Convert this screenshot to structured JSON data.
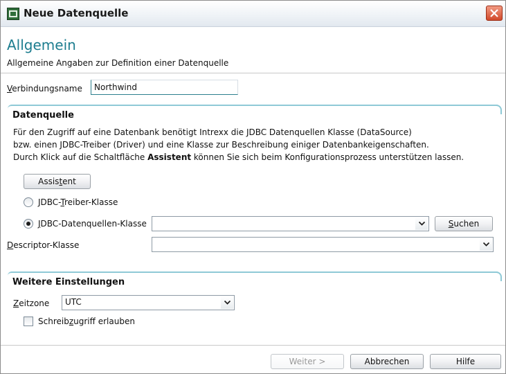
{
  "window": {
    "title": "Neue Datenquelle"
  },
  "header": {
    "heading": "Allgemein",
    "subheading": "Allgemeine Angaben zur Definition einer Datenquelle"
  },
  "connection": {
    "label_accel": "V",
    "label_rest": "erbindungsname",
    "value": "Northwind"
  },
  "datasource": {
    "group_title": "Datenquelle",
    "desc_line1": "Für den Zugriff auf eine Datenbank benötigt Intrexx die JDBC Datenquellen Klasse (DataSource)",
    "desc_line2": "bzw. einen JDBC-Treiber (Driver) und eine Klasse zur Beschreibung einiger Datenbankeigenschaften.",
    "desc_line3_a": "Durch Klick auf die Schaltfläche ",
    "desc_line3_b": "Assistent",
    "desc_line3_c": " können Sie sich beim Konfigurationsprozess unterstützen lassen.",
    "assistant_button": {
      "pre": "Assis",
      "accel": "t",
      "post": "ent"
    },
    "driver_radio": {
      "pre": "JDBC-",
      "accel": "T",
      "post": "reiber-Klasse",
      "checked": false
    },
    "ds_radio": {
      "pre": "",
      "accel": "J",
      "post": "DBC-Datenquellen-Klasse",
      "checked": true,
      "value": ""
    },
    "search_button": {
      "pre": "",
      "accel": "S",
      "post": "uchen"
    },
    "descriptor": {
      "label_accel": "D",
      "label_rest": "escriptor-Klasse",
      "value": ""
    }
  },
  "further": {
    "group_title": "Weitere Einstellungen",
    "timezone": {
      "label_accel": "Z",
      "label_rest": "eitzone",
      "value": "UTC"
    },
    "write_access": {
      "pre": "Schreib",
      "accel": "z",
      "post": "ugriff erlauben",
      "checked": false
    }
  },
  "footer": {
    "next_button": "Weiter >",
    "cancel_button": "Abbrechen",
    "help_button": "Hilfe"
  },
  "colors": {
    "heading": "#1d7d8f",
    "group_border": "#8ec9d6",
    "field_accent": "#2c7f8d",
    "close_button": "#d1492a"
  },
  "icons": {
    "app": "datasource-app-icon",
    "close": "close-icon",
    "combo_arrow": "chevron-down-icon"
  }
}
